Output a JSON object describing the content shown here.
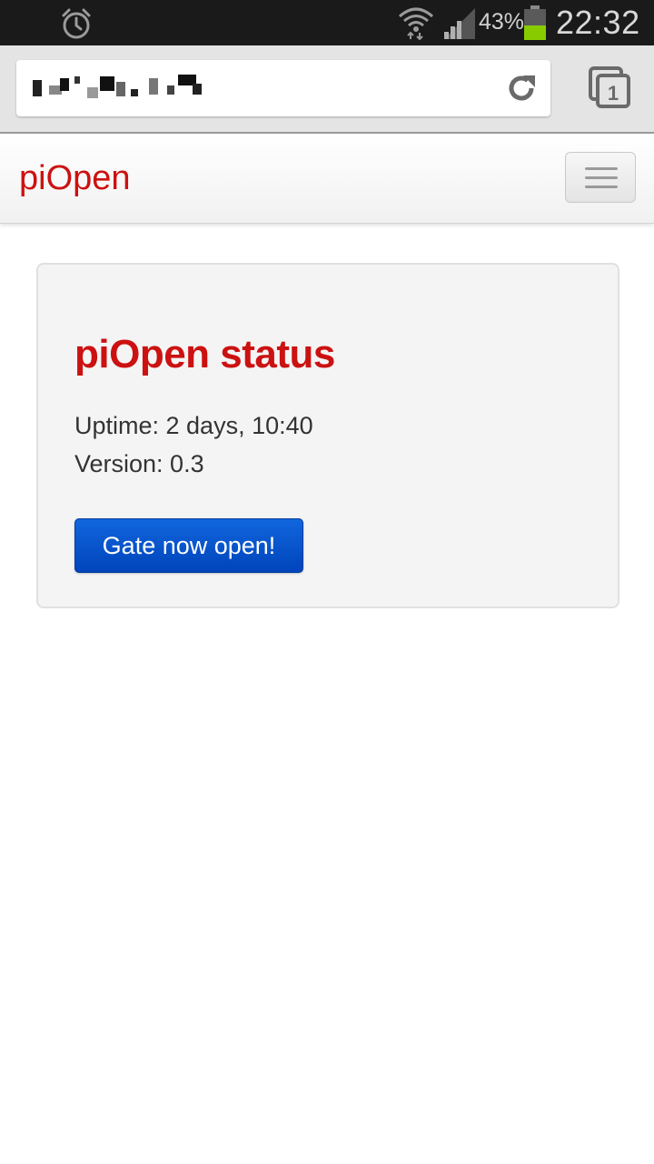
{
  "status_bar": {
    "battery_percent": "43%",
    "battery_level": 0.43,
    "time": "22:32",
    "icons": [
      "alarm-icon",
      "wifi-icon",
      "signal-icon",
      "battery-icon"
    ]
  },
  "browser": {
    "url_display": "redacted",
    "icons": [
      "reload-icon",
      "tabs-icon"
    ],
    "tab_count": "1"
  },
  "navbar": {
    "brand": "piOpen",
    "menu_icon": "hamburger-menu-icon"
  },
  "status_card": {
    "title": "piOpen status",
    "uptime": "Uptime: 2 days, 10:40",
    "version": "Version: 0.3",
    "gate_button_label": "Gate now open!"
  },
  "colors": {
    "brand_red": "#cc1111",
    "button_blue": "#0055cc",
    "battery_green": "#88cc00"
  }
}
